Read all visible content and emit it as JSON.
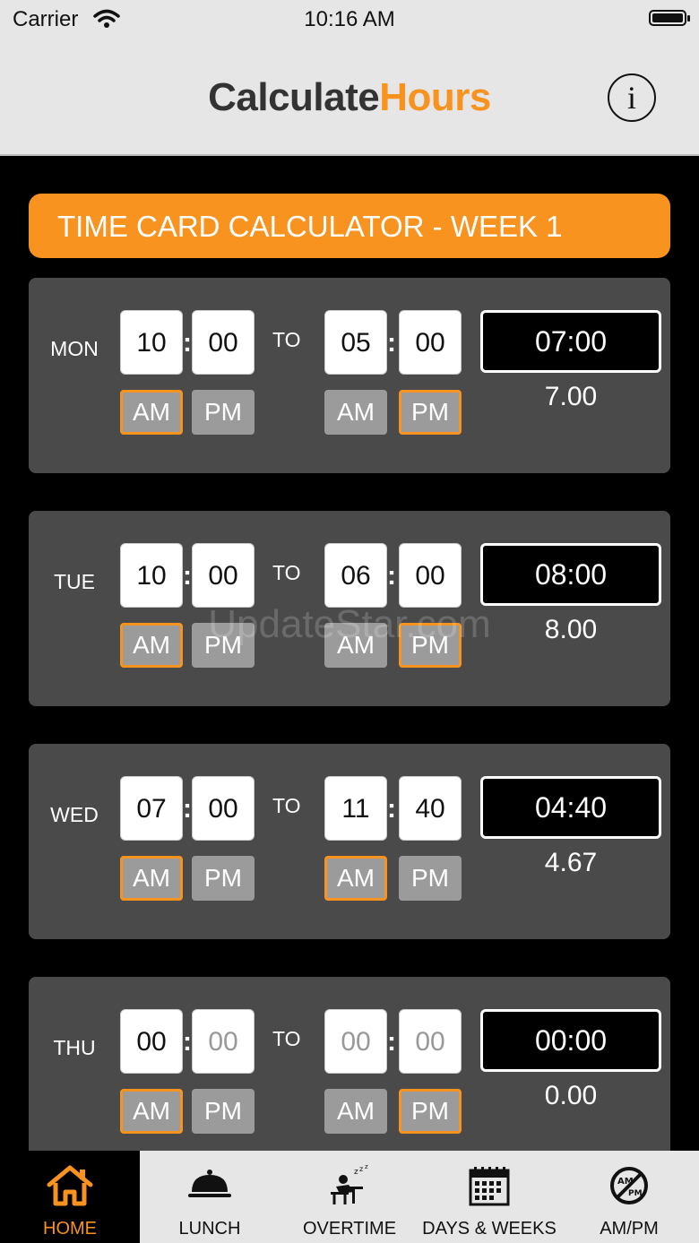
{
  "status": {
    "carrier": "Carrier",
    "time": "10:16 AM"
  },
  "nav": {
    "brand_dark": "Calculate",
    "brand_accent": "Hours",
    "info": "i"
  },
  "header": {
    "title": "TIME CARD CALCULATOR - WEEK 1"
  },
  "labels": {
    "to": "TO",
    "am": "AM",
    "pm": "PM"
  },
  "days": [
    {
      "day": "MON",
      "start_h": "10",
      "start_m": "00",
      "end_h": "05",
      "end_m": "00",
      "total": "07:00",
      "decimal": "7.00"
    },
    {
      "day": "TUE",
      "start_h": "10",
      "start_m": "00",
      "end_h": "06",
      "end_m": "00",
      "total": "08:00",
      "decimal": "8.00"
    },
    {
      "day": "WED",
      "start_h": "07",
      "start_m": "00",
      "end_h": "11",
      "end_m": "40",
      "total": "04:40",
      "decimal": "4.67"
    },
    {
      "day": "THU",
      "start_h": "00",
      "start_m": "00",
      "end_h": "00",
      "end_m": "00",
      "total": "00:00",
      "decimal": "0.00"
    }
  ],
  "tabs": [
    {
      "label": "HOME",
      "icon": "home-icon"
    },
    {
      "label": "LUNCH",
      "icon": "cloche-icon"
    },
    {
      "label": "OVERTIME",
      "icon": "sleeping-worker-icon"
    },
    {
      "label": "DAYS & WEEKS",
      "icon": "calendar-icon"
    },
    {
      "label": "AM/PM",
      "icon": "no-ampm-icon"
    }
  ],
  "colors": {
    "accent": "#f7931e",
    "card": "#4a4a4a",
    "background": "#000000"
  },
  "watermark": "UpdateStar.com"
}
